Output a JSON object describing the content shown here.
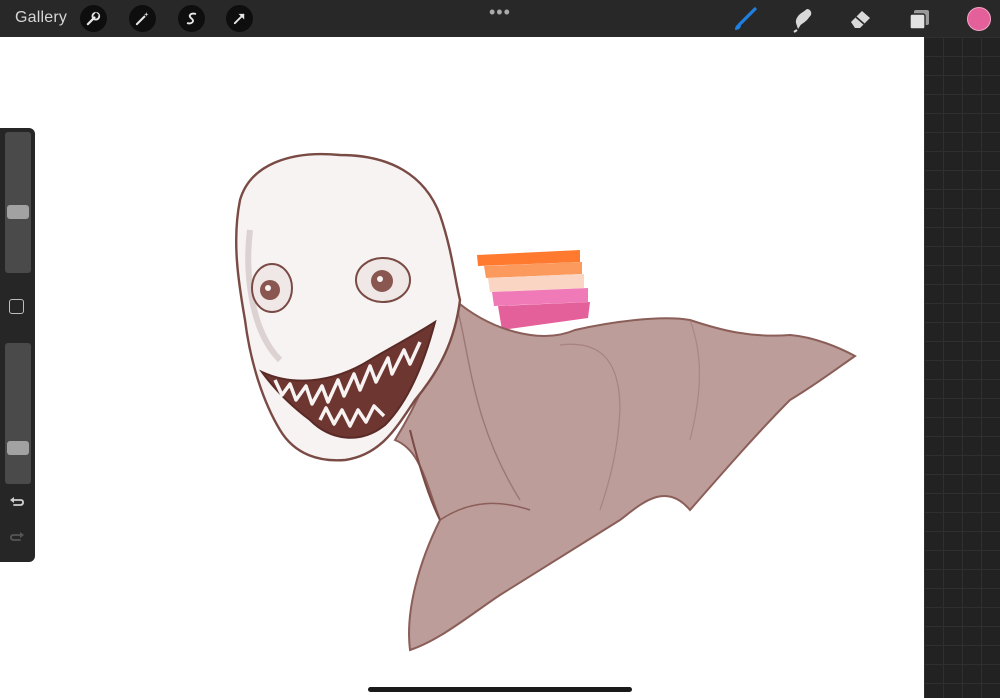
{
  "topbar": {
    "gallery_label": "Gallery",
    "left_tools": [
      "wrench-icon",
      "magic-wand-icon",
      "selection-icon",
      "transform-arrow-icon"
    ],
    "more_label": "•••",
    "right_tools": [
      "brush-icon",
      "smudge-icon",
      "eraser-icon",
      "layers-icon"
    ],
    "current_color": "#e4609a"
  },
  "sidebar": {
    "brush_size_level": 0.42,
    "opacity_level": 0.22
  },
  "colors": {
    "flag_stripes": [
      "#ff7a2e",
      "#fc9a5e",
      "#fbd5c4",
      "#f07ab8",
      "#e4609a"
    ],
    "body_fill": "#bc9d9a",
    "line_color": "#7a4a44"
  }
}
